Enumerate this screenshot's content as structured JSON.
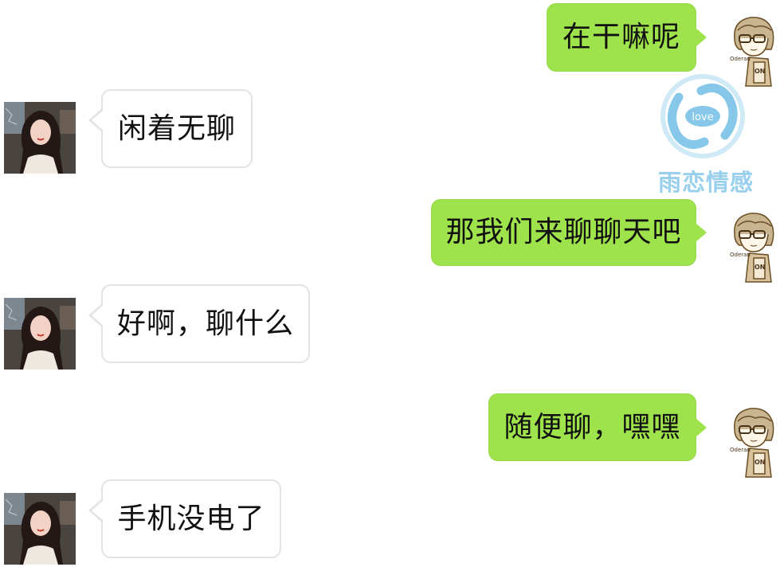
{
  "messages": [
    {
      "side": "sent",
      "text": "在干嘛呢"
    },
    {
      "side": "received",
      "text": "闲着无聊"
    },
    {
      "side": "sent",
      "text": "那我们来聊聊天吧"
    },
    {
      "side": "received",
      "text": "好啊，聊什么"
    },
    {
      "side": "sent",
      "text": "随便聊，嘿嘿"
    },
    {
      "side": "received",
      "text": "手机没电了"
    }
  ],
  "avatars": {
    "self_icon": "cartoon-boy-avatar-icon",
    "self_signature": "Oderan",
    "contact_icon": "girl-photo-avatar-icon"
  },
  "watermark": {
    "logo_icon": "love-circle-logo-icon",
    "logo_word": "love",
    "text": "雨恋情感"
  },
  "colors": {
    "sent_bubble": "#9ee34c",
    "received_bubble": "#ffffff",
    "received_border": "#e3e3e3",
    "watermark": "#86c7ea",
    "background": "#ffffff"
  }
}
